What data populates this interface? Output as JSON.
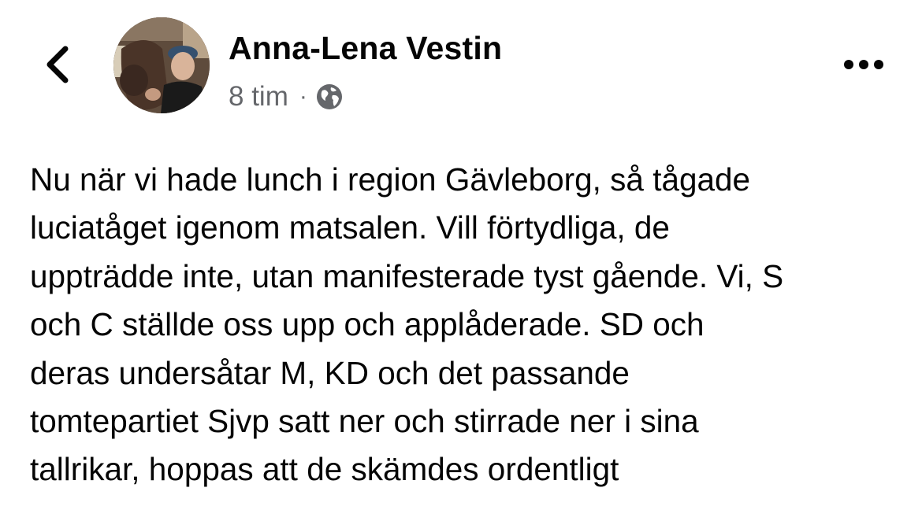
{
  "post": {
    "author": "Anna-Lena Vestin",
    "time": "8 tim",
    "separator": "·",
    "privacy_icon": "globe-icon",
    "lines": [
      "Nu när vi hade lunch i region Gävleborg, så tågade",
      "luciatåget igenom matsalen. Vill förtydliga, de",
      "uppträdde inte, utan manifesterade tyst gående. Vi, S",
      "och C ställde oss upp och applåderade. SD och",
      "deras undersåtar M, KD och det passande",
      "tomtepartiet Sjvp satt ner och stirrade ner i sina",
      "tallrikar, hoppas att de skämdes ordentligt"
    ]
  },
  "nav": {
    "back_icon": "chevron-left-icon",
    "more_icon": "more-horizontal-icon"
  },
  "colors": {
    "text": "#050505",
    "secondary_text": "#65676b",
    "background": "#ffffff"
  }
}
